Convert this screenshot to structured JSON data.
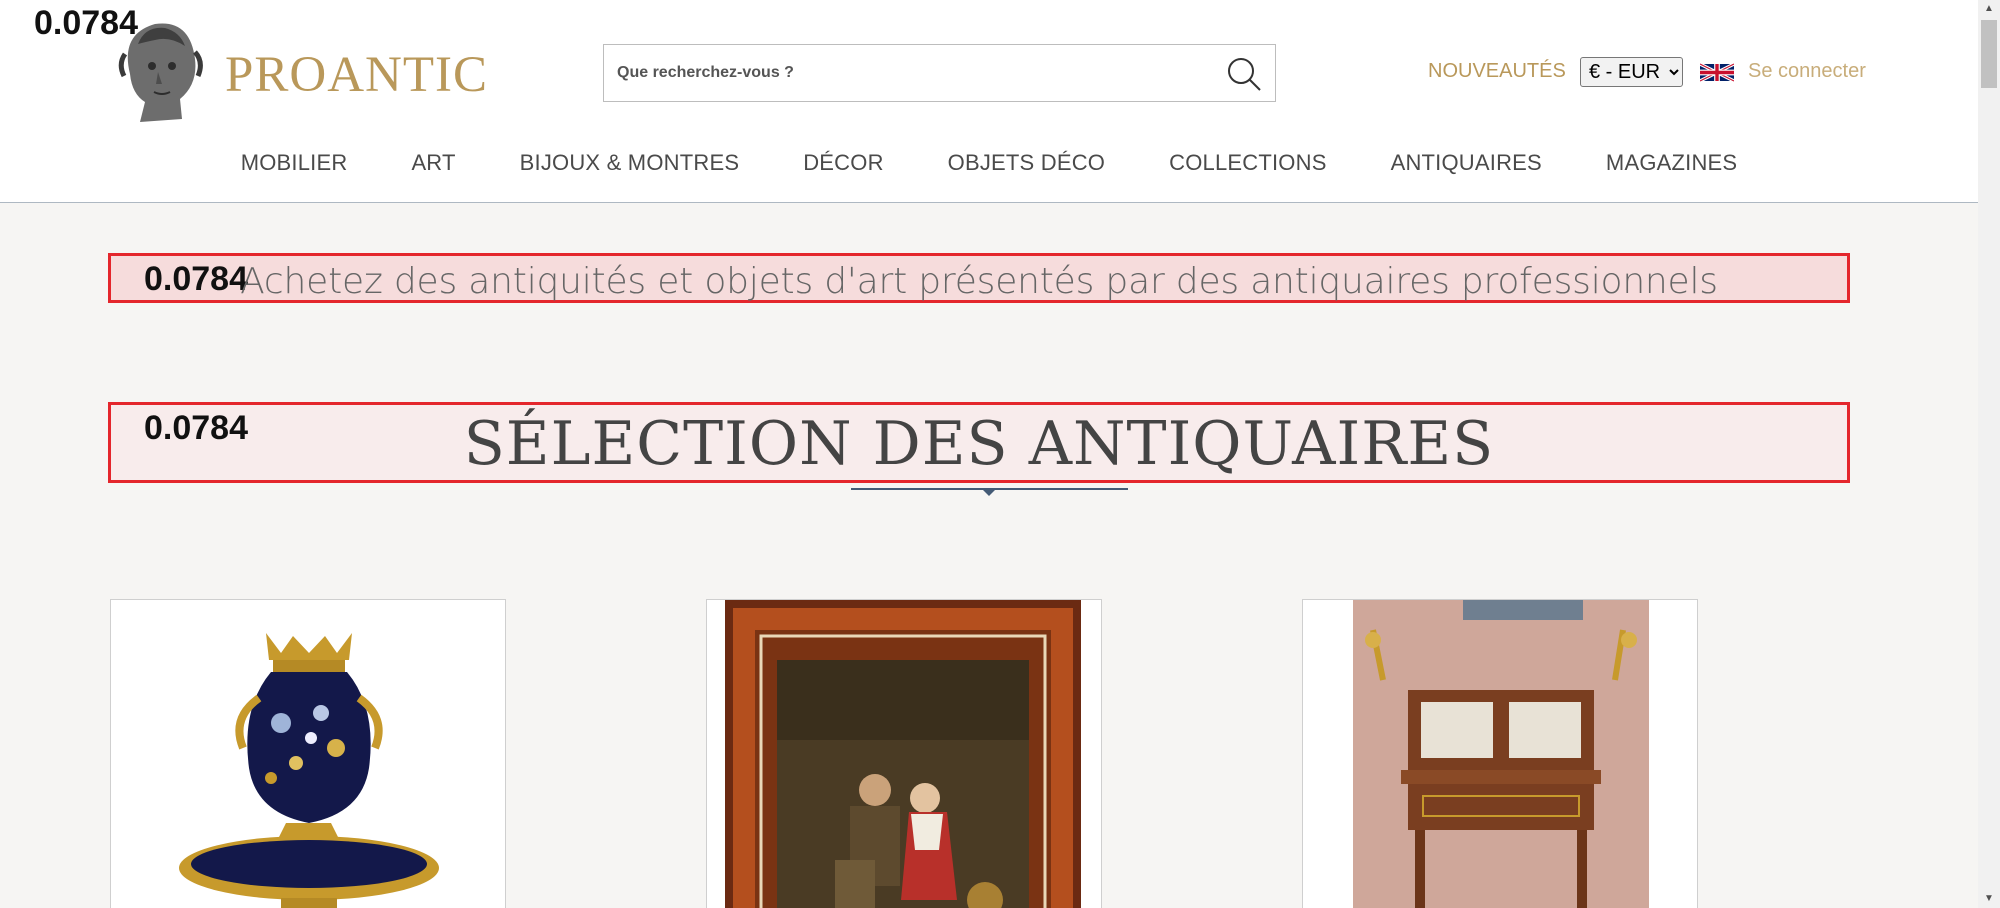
{
  "debug": {
    "top_value": "0.0784"
  },
  "brand": {
    "name": "PROANTIC"
  },
  "search": {
    "placeholder": "Que recherchez-vous ?"
  },
  "header": {
    "nouveautes": "NOUVEAUTÉS",
    "currency_selected": "€ - EUR",
    "language_flag": "uk-flag-icon",
    "login": "Se connecter"
  },
  "nav": {
    "items": [
      {
        "label": "MOBILIER"
      },
      {
        "label": "ART"
      },
      {
        "label": "BIJOUX & MONTRES"
      },
      {
        "label": "DÉCOR"
      },
      {
        "label": "OBJETS DÉCO"
      },
      {
        "label": "COLLECTIONS"
      },
      {
        "label": "ANTIQUAIRES"
      },
      {
        "label": "MAGAZINES"
      }
    ]
  },
  "banners": {
    "tagline": {
      "value": "0.0784",
      "text": "Achetez des antiquités et objets d'art présentés par des antiquaires professionnels"
    },
    "section": {
      "value": "0.0784",
      "text": "SÉLECTION DES ANTIQUAIRES"
    }
  },
  "colors": {
    "brand_gold": "#b9985a",
    "highlight_border": "#e4262c",
    "divider": "#435a75"
  }
}
